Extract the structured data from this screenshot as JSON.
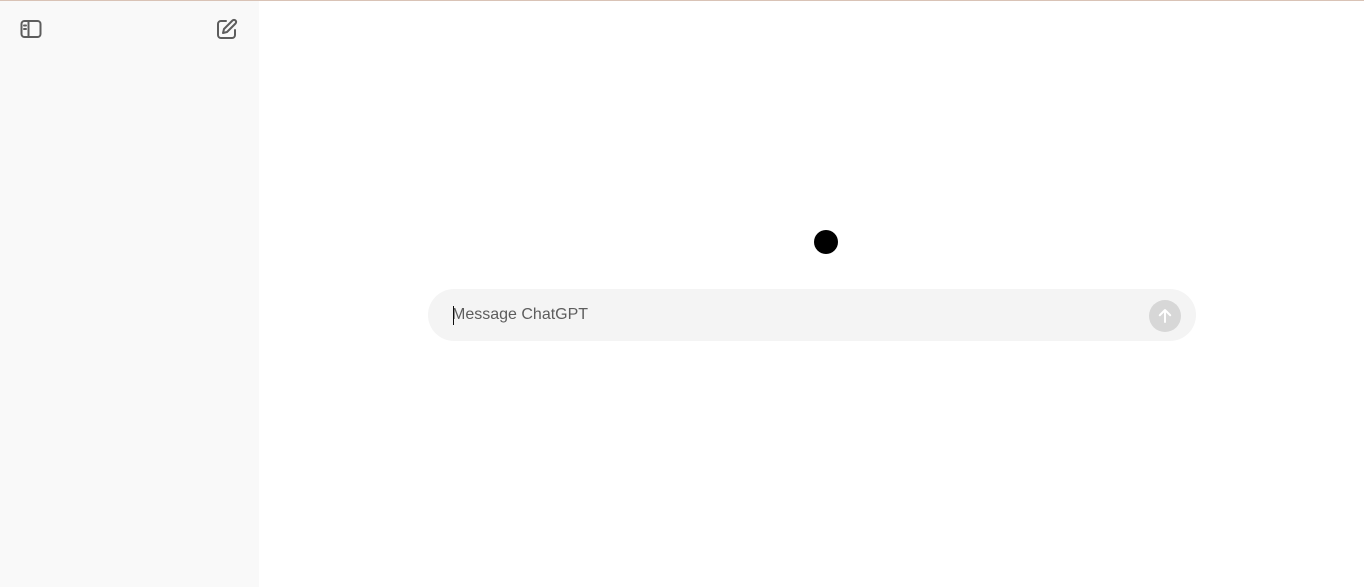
{
  "sidebar": {
    "toggle": {
      "icon": "sidebar-toggle-icon"
    },
    "new_chat": {
      "icon": "new-chat-icon"
    }
  },
  "composer": {
    "placeholder": "Message ChatGPT",
    "value": "",
    "send_icon": "arrow-up-icon"
  },
  "colors": {
    "sidebar_bg": "#f9f9f9",
    "main_bg": "#ffffff",
    "composer_bg": "#f4f4f4",
    "send_disabled": "#d7d7d7",
    "icon": "#5d5d5d"
  }
}
